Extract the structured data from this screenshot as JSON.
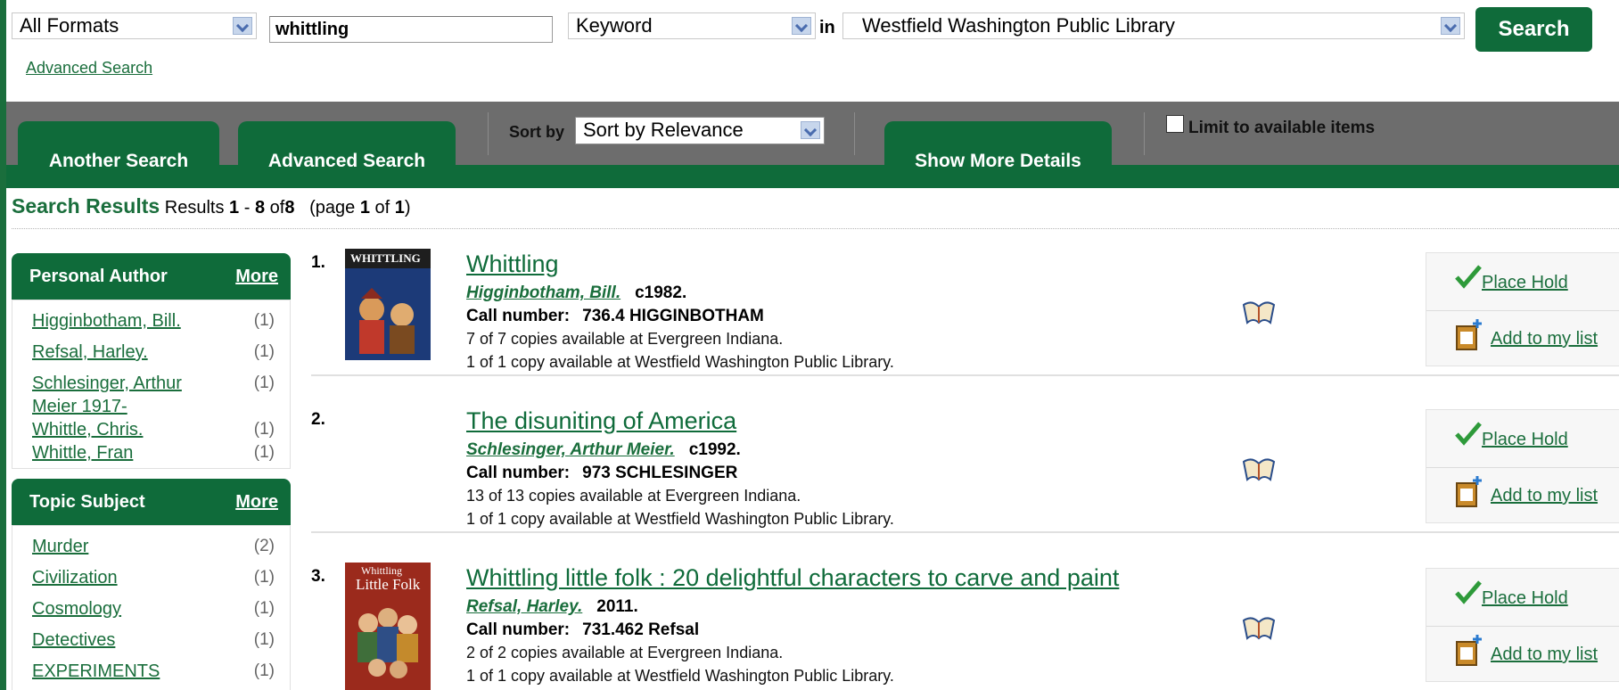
{
  "search": {
    "format": "All Formats",
    "query": "whittling",
    "type": "Keyword",
    "in_label": "in",
    "library": "Westfield Washington Public Library",
    "button": "Search",
    "advanced_link": "Advanced Search"
  },
  "tabs": {
    "another_search": "Another Search",
    "advanced_search": "Advanced Search",
    "sort_label": "Sort by",
    "sort_value": "Sort by Relevance",
    "show_more": "Show More Details",
    "limit_label": "Limit to available items"
  },
  "summary": {
    "heading": "Search Results",
    "results_word": "Results",
    "from": "1",
    "dash": "-",
    "to": "8",
    "of_word": "of",
    "total": "8",
    "page_open": "(page",
    "page": "1",
    "page_of": "of",
    "pages": "1",
    "page_close": ")"
  },
  "facets": {
    "author": {
      "title": "Personal Author",
      "more": "More",
      "items": [
        {
          "label": "Higginbotham, Bill.",
          "count": "(1)"
        },
        {
          "label": "Refsal, Harley.",
          "count": "(1)"
        },
        {
          "label": "Schlesinger, Arthur Meier 1917-",
          "count": "(1)"
        },
        {
          "label": "Whittle, Chris.",
          "count": "(1)"
        },
        {
          "label": "Whittle, Fran",
          "count": "(1)"
        }
      ]
    },
    "topic": {
      "title": "Topic Subject",
      "more": "More",
      "items": [
        {
          "label": "Murder",
          "count": "(2)"
        },
        {
          "label": "Civilization",
          "count": "(1)"
        },
        {
          "label": "Cosmology",
          "count": "(1)"
        },
        {
          "label": "Detectives",
          "count": "(1)"
        },
        {
          "label": "EXPERIMENTS",
          "count": "(1)"
        }
      ]
    }
  },
  "results": [
    {
      "num": "1.",
      "title": "Whittling",
      "author": "Higginbotham, Bill.",
      "date": "c1982.",
      "call_label": "Call number:",
      "call_value": "736.4 HIGGINBOTHAM",
      "avail1": "7 of 7 copies available at Evergreen Indiana.",
      "avail2": "1 of 1 copy available at Westfield Washington Public Library.",
      "cover_text": "WHITTLING",
      "place_hold": "Place Hold",
      "add_list": "Add to my list"
    },
    {
      "num": "2.",
      "title": "The disuniting of America",
      "author": "Schlesinger, Arthur Meier.",
      "date": "c1992.",
      "call_label": "Call number:",
      "call_value": "973 SCHLESINGER",
      "avail1": "13 of 13 copies available at Evergreen Indiana.",
      "avail2": "1 of 1 copy available at Westfield Washington Public Library.",
      "place_hold": "Place Hold",
      "add_list": "Add to my list"
    },
    {
      "num": "3.",
      "title": "Whittling little folk : 20 delightful characters to carve and paint",
      "author": "Refsal, Harley.",
      "date": "2011.",
      "call_label": "Call number:",
      "call_value": "731.462 Refsal",
      "avail1": "2 of 2 copies available at Evergreen Indiana.",
      "avail2": "1 of 1 copy available at Westfield Washington Public Library.",
      "cover_text_1": "Whittling",
      "cover_text_2": "Little Folk",
      "place_hold": "Place Hold",
      "add_list": "Add to my list"
    }
  ],
  "colors": {
    "brand_green": "#0f6b3a",
    "link_green": "#1a6e3c",
    "tabbar_gray": "#6d6d6d"
  }
}
